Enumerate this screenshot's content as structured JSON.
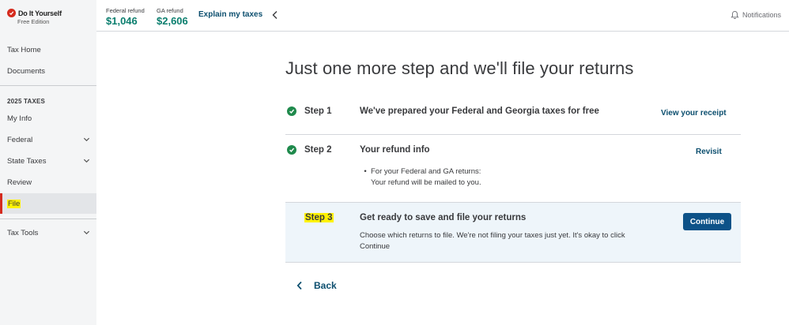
{
  "brand": {
    "name": "Do It Yourself",
    "edition": "Free Edition"
  },
  "sidebar": {
    "items_top": [
      {
        "label": "Tax Home"
      },
      {
        "label": "Documents"
      }
    ],
    "section_title": "2025 TAXES",
    "items": [
      {
        "label": "My Info",
        "expandable": false
      },
      {
        "label": "Federal",
        "expandable": true
      },
      {
        "label": "State Taxes",
        "expandable": true
      },
      {
        "label": "Review",
        "expandable": false
      },
      {
        "label": "File",
        "expandable": false,
        "active": true
      }
    ],
    "tools": {
      "label": "Tax Tools",
      "expandable": true
    }
  },
  "topbar": {
    "federal_label": "Federal refund",
    "federal_value": "$1,046",
    "state_label": "GA refund",
    "state_value": "$2,606",
    "explain_label": "Explain my taxes",
    "notifications_label": "Notifications"
  },
  "main": {
    "heading": "Just one more step and we'll file your returns",
    "steps": [
      {
        "number": "Step 1",
        "title": "We've prepared your Federal and Georgia taxes for free",
        "action": "View your receipt",
        "complete": true
      },
      {
        "number": "Step 2",
        "title": "Your refund info",
        "action": "Revisit",
        "complete": true,
        "detail_line1": "For your Federal and GA returns:",
        "detail_line2": "Your refund will be mailed to you."
      },
      {
        "number": "Step 3",
        "title": "Get ready to save and file your returns",
        "action": "Continue",
        "complete": false,
        "detail_line1": "Choose which returns to file. We're not filing your taxes just yet. It's okay to click",
        "detail_line2": "Continue"
      }
    ],
    "back_label": "Back"
  },
  "colors": {
    "accent_teal": "#0a7e6e",
    "link_blue": "#0b4e6e",
    "button_blue": "#0d5288",
    "check_green": "#1f8a4c",
    "active_marker": "#d52b1e",
    "highlight": "#fff200"
  }
}
